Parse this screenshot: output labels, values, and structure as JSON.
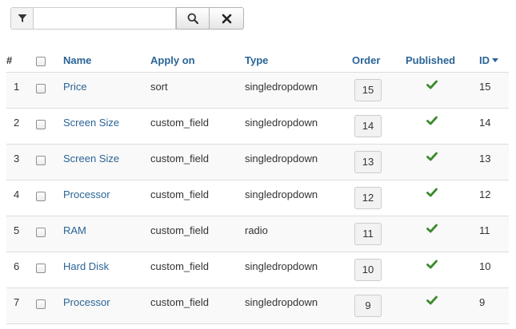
{
  "filter": {
    "search_value": "",
    "search_placeholder": ""
  },
  "columns": {
    "num": "#",
    "name": "Name",
    "apply_on": "Apply on",
    "type": "Type",
    "order": "Order",
    "published": "Published",
    "id": "ID"
  },
  "accent_colors": {
    "link": "#2a6496",
    "published_check": "#3c8a2e"
  },
  "rows": [
    {
      "num": "1",
      "name": "Price",
      "apply_on": "sort",
      "type": "singledropdown",
      "order": "15",
      "published": true,
      "id": "15"
    },
    {
      "num": "2",
      "name": "Screen Size",
      "apply_on": "custom_field",
      "type": "singledropdown",
      "order": "14",
      "published": true,
      "id": "14"
    },
    {
      "num": "3",
      "name": "Screen Size",
      "apply_on": "custom_field",
      "type": "singledropdown",
      "order": "13",
      "published": true,
      "id": "13"
    },
    {
      "num": "4",
      "name": "Processor",
      "apply_on": "custom_field",
      "type": "singledropdown",
      "order": "12",
      "published": true,
      "id": "12"
    },
    {
      "num": "5",
      "name": "RAM",
      "apply_on": "custom_field",
      "type": "radio",
      "order": "11",
      "published": true,
      "id": "11"
    },
    {
      "num": "6",
      "name": "Hard Disk",
      "apply_on": "custom_field",
      "type": "singledropdown",
      "order": "10",
      "published": true,
      "id": "10"
    },
    {
      "num": "7",
      "name": "Processor",
      "apply_on": "custom_field",
      "type": "singledropdown",
      "order": "9",
      "published": true,
      "id": "9"
    }
  ]
}
